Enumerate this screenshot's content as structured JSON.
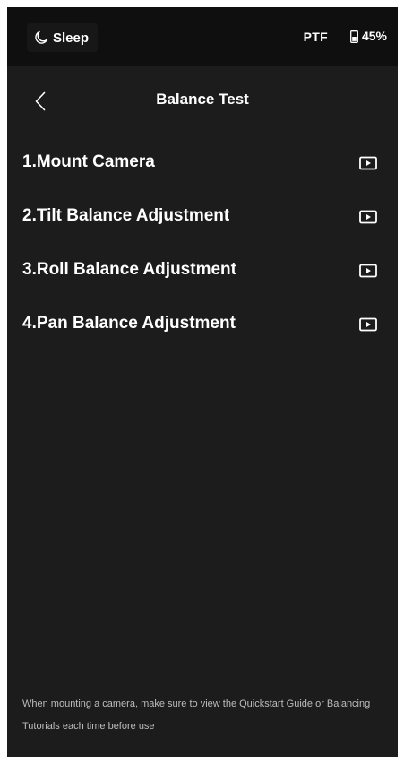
{
  "status_bar": {
    "sleep_label": "Sleep",
    "mode_label": "PTF",
    "battery_level": "45%"
  },
  "header": {
    "title": "Balance Test"
  },
  "steps": [
    {
      "label": "1.Mount Camera",
      "icon": "video-play-icon"
    },
    {
      "label": "2.Tilt Balance Adjustment",
      "icon": "video-play-icon"
    },
    {
      "label": "3.Roll Balance Adjustment",
      "icon": "video-play-icon"
    },
    {
      "label": "4.Pan Balance Adjustment",
      "icon": "video-play-icon"
    }
  ],
  "footer": {
    "note": "When mounting a camera, make sure to view the Quickstart Guide or Balancing Tutorials each time before use"
  },
  "colors": {
    "background": "#1c1c1c",
    "status_bar_background": "#0f0f0f",
    "text": "#ffffff",
    "secondary_text": "#bdbdbd"
  }
}
